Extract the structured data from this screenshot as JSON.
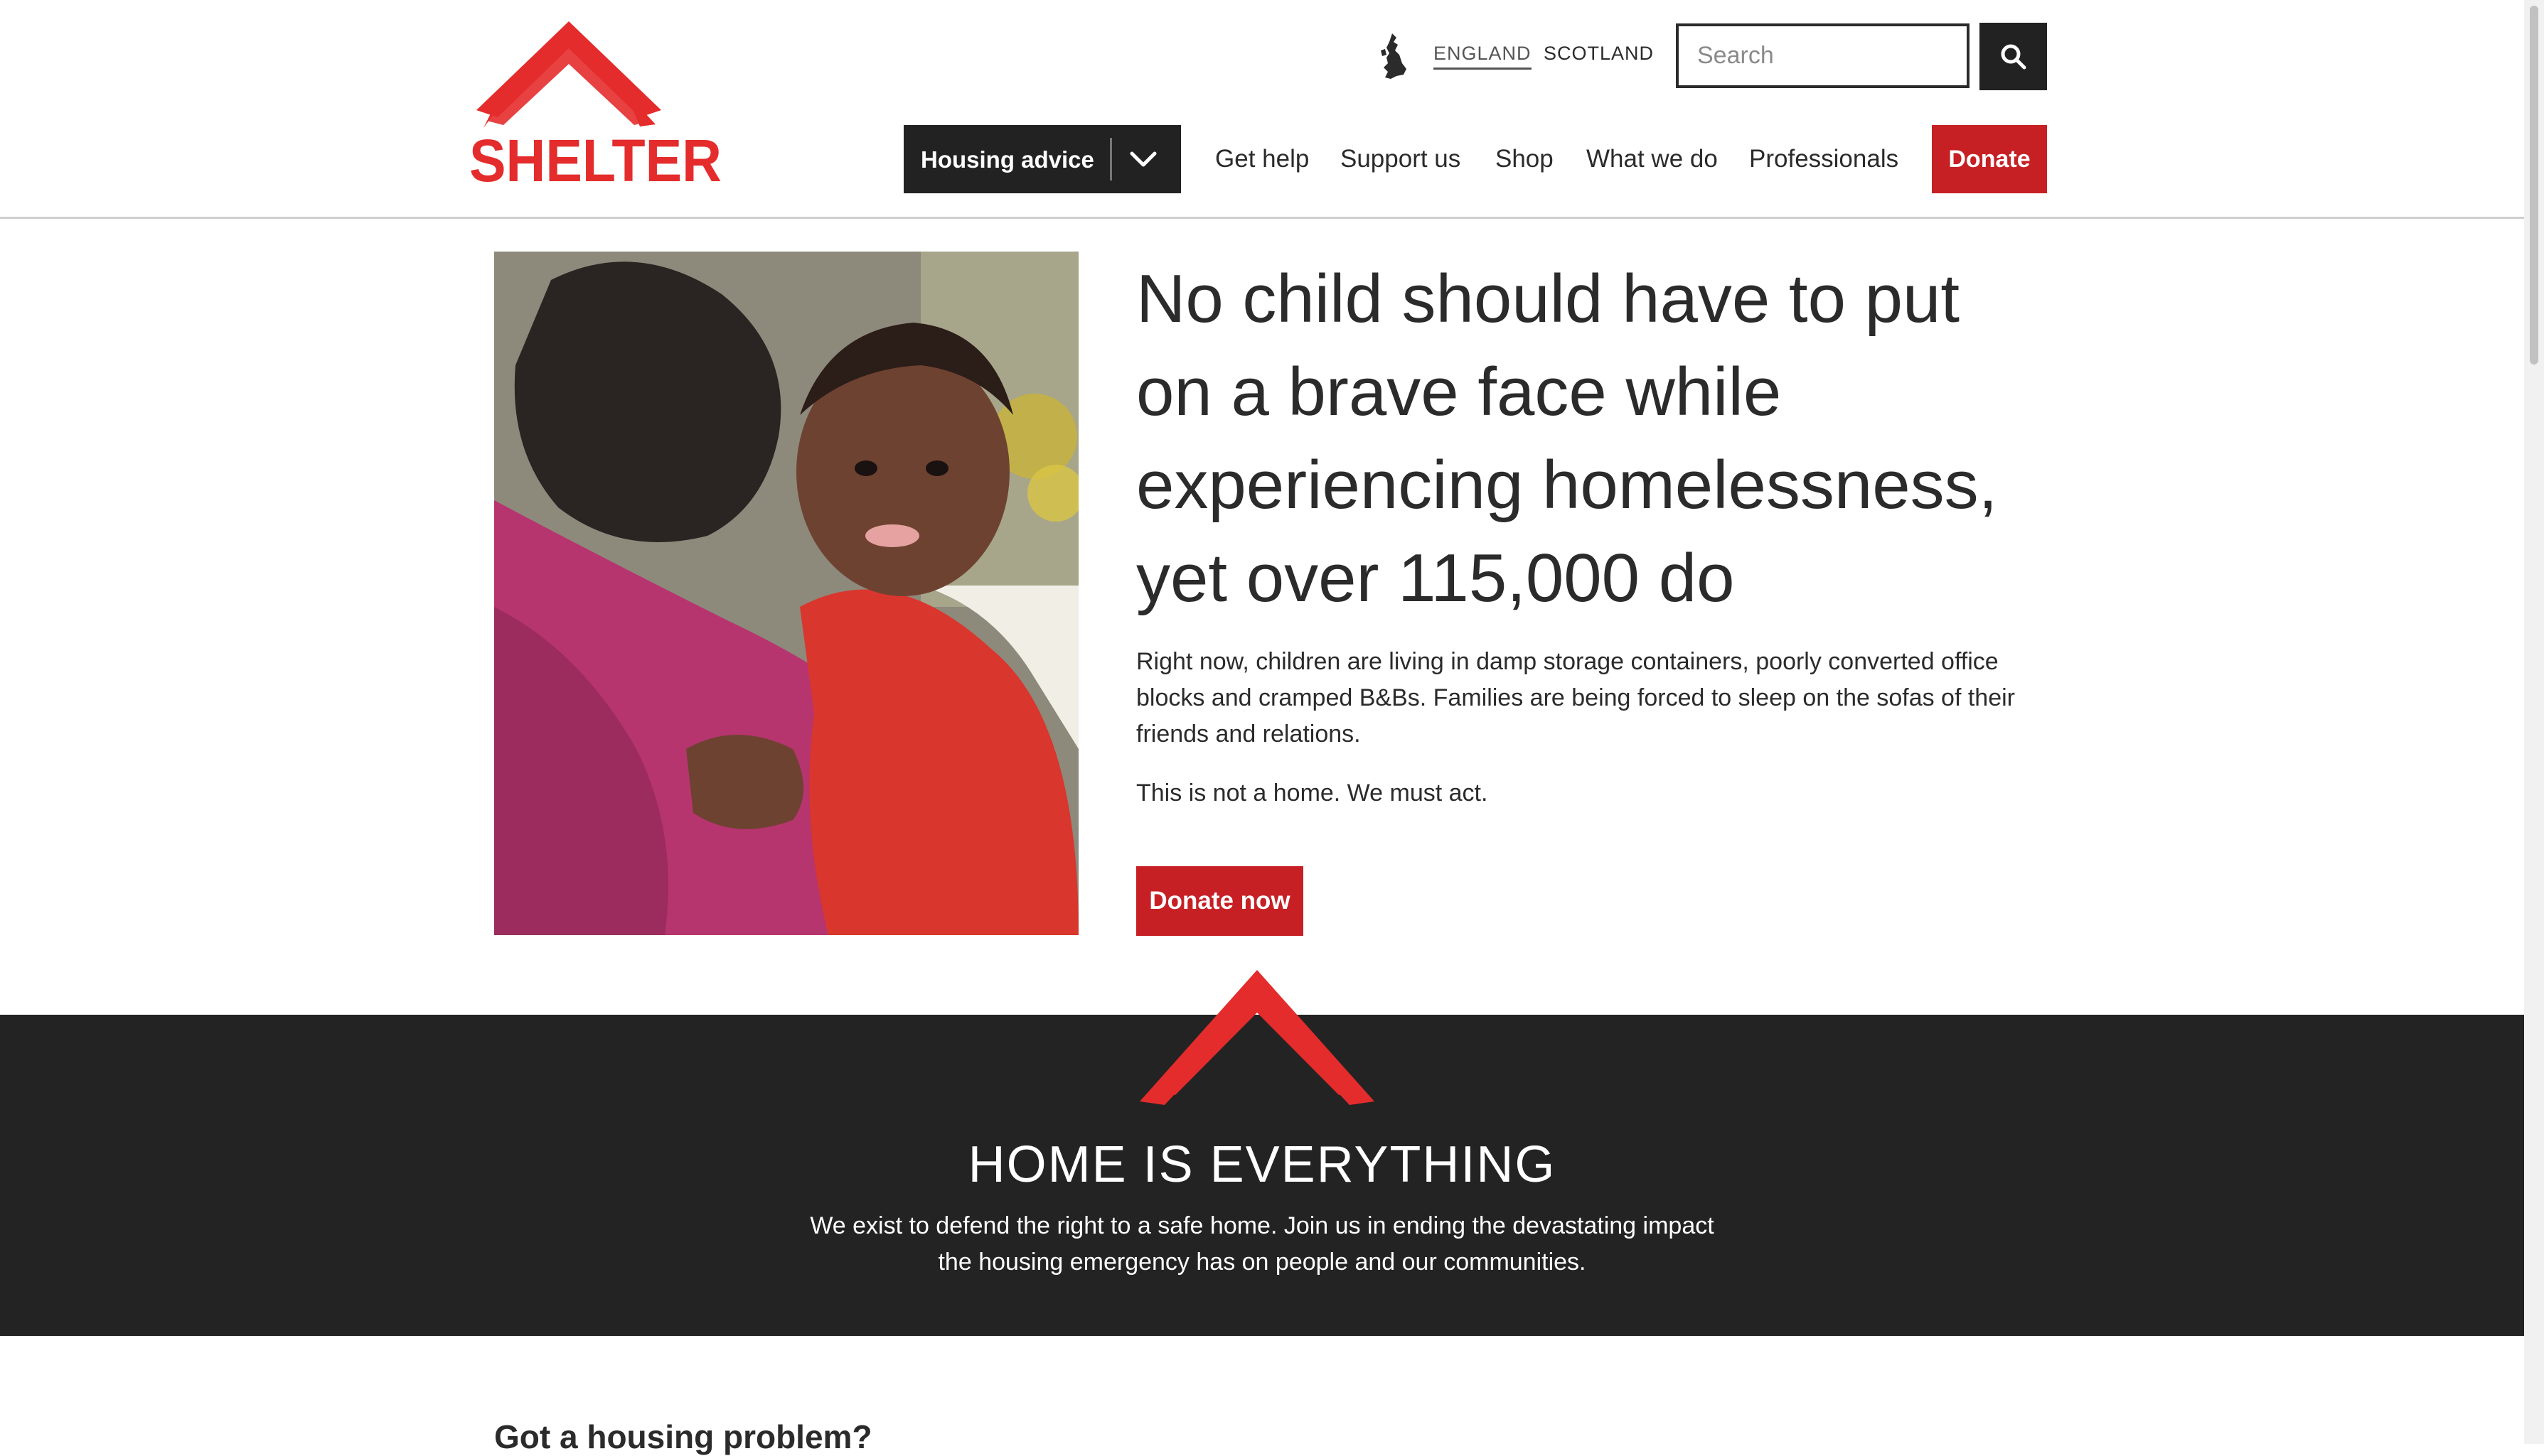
{
  "header": {
    "logo_text": "SHELTER",
    "countries": [
      "ENGLAND",
      "SCOTLAND"
    ],
    "search": {
      "placeholder": "Search"
    },
    "nav": {
      "dropdown_label": "Housing advice",
      "links": [
        "Get help",
        "Support us",
        "Shop",
        "What we do",
        "Professionals"
      ],
      "donate_label": "Donate"
    }
  },
  "hero": {
    "title": "No child should have to put on a brave face while experiencing homelessness, yet over 115,000 do",
    "paragraph1": "Right now, children are living in damp storage containers, poorly converted office blocks and cramped B&Bs. Families are being forced to sleep on the sofas of their friends and relations.",
    "paragraph2": "This is not a home. We must act.",
    "cta_label": "Donate now"
  },
  "band": {
    "title": "HOME IS EVERYTHING",
    "text": "We exist to defend the right to a safe home. Join us in ending the devastating impact the housing emergency has on people and our communities."
  },
  "next_section": {
    "heading": "Got a housing problem?"
  },
  "colors": {
    "brand_red": "#e42c2c",
    "button_red": "#c62025",
    "dark": "#232323"
  },
  "icons": {
    "search": "search-icon",
    "dropdown": "chevron-down-icon",
    "region": "uk-map-icon"
  }
}
